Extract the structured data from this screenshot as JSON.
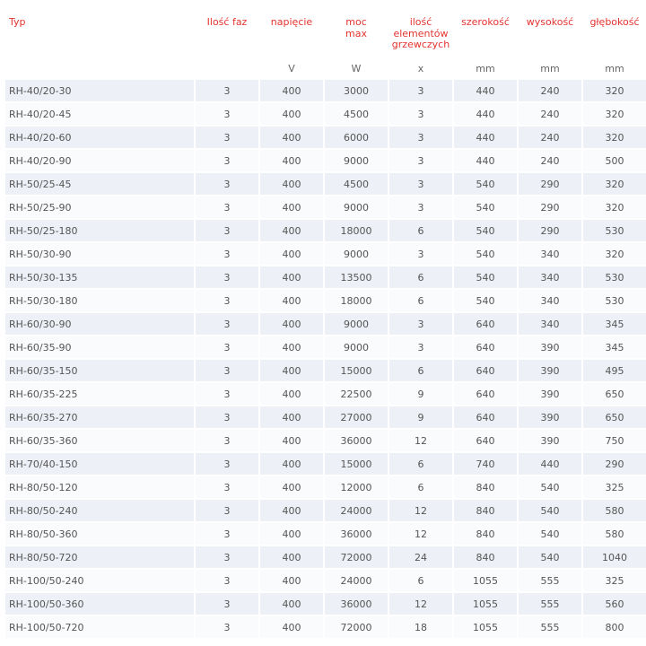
{
  "headers": [
    "Typ",
    "Ilość faz",
    "napięcie",
    "moc\nmax",
    "ilość elementów grzewczych",
    "szerokość",
    "wysokość",
    "głębokość"
  ],
  "units": [
    "",
    "",
    "V",
    "W",
    "x",
    "mm",
    "mm",
    "mm"
  ],
  "rows": [
    [
      "RH-40/20-30",
      "3",
      "400",
      "3000",
      "3",
      "440",
      "240",
      "320"
    ],
    [
      "RH-40/20-45",
      "3",
      "400",
      "4500",
      "3",
      "440",
      "240",
      "320"
    ],
    [
      "RH-40/20-60",
      "3",
      "400",
      "6000",
      "3",
      "440",
      "240",
      "320"
    ],
    [
      "RH-40/20-90",
      "3",
      "400",
      "9000",
      "3",
      "440",
      "240",
      "500"
    ],
    [
      "RH-50/25-45",
      "3",
      "400",
      "4500",
      "3",
      "540",
      "290",
      "320"
    ],
    [
      "RH-50/25-90",
      "3",
      "400",
      "9000",
      "3",
      "540",
      "290",
      "320"
    ],
    [
      "RH-50/25-180",
      "3",
      "400",
      "18000",
      "6",
      "540",
      "290",
      "530"
    ],
    [
      "RH-50/30-90",
      "3",
      "400",
      "9000",
      "3",
      "540",
      "340",
      "320"
    ],
    [
      "RH-50/30-135",
      "3",
      "400",
      "13500",
      "6",
      "540",
      "340",
      "530"
    ],
    [
      "RH-50/30-180",
      "3",
      "400",
      "18000",
      "6",
      "540",
      "340",
      "530"
    ],
    [
      "RH-60/30-90",
      "3",
      "400",
      "9000",
      "3",
      "640",
      "340",
      "345"
    ],
    [
      "RH-60/35-90",
      "3",
      "400",
      "9000",
      "3",
      "640",
      "390",
      "345"
    ],
    [
      "RH-60/35-150",
      "3",
      "400",
      "15000",
      "6",
      "640",
      "390",
      "495"
    ],
    [
      "RH-60/35-225",
      "3",
      "400",
      "22500",
      "9",
      "640",
      "390",
      "650"
    ],
    [
      "RH-60/35-270",
      "3",
      "400",
      "27000",
      "9",
      "640",
      "390",
      "650"
    ],
    [
      "RH-60/35-360",
      "3",
      "400",
      "36000",
      "12",
      "640",
      "390",
      "750"
    ],
    [
      "RH-70/40-150",
      "3",
      "400",
      "15000",
      "6",
      "740",
      "440",
      "290"
    ],
    [
      "RH-80/50-120",
      "3",
      "400",
      "12000",
      "6",
      "840",
      "540",
      "325"
    ],
    [
      "RH-80/50-240",
      "3",
      "400",
      "24000",
      "12",
      "840",
      "540",
      "580"
    ],
    [
      "RH-80/50-360",
      "3",
      "400",
      "36000",
      "12",
      "840",
      "540",
      "580"
    ],
    [
      "RH-80/50-720",
      "3",
      "400",
      "72000",
      "24",
      "840",
      "540",
      "1040"
    ],
    [
      "RH-100/50-240",
      "3",
      "400",
      "24000",
      "6",
      "1055",
      "555",
      "325"
    ],
    [
      "RH-100/50-360",
      "3",
      "400",
      "36000",
      "12",
      "1055",
      "555",
      "560"
    ],
    [
      "RH-100/50-720",
      "3",
      "400",
      "72000",
      "18",
      "1055",
      "555",
      "800"
    ]
  ],
  "colors": {
    "header_text": "#e3342f",
    "row_odd": "#eef0f7",
    "row_even": "#fafbfd",
    "body_text": "#555555"
  }
}
